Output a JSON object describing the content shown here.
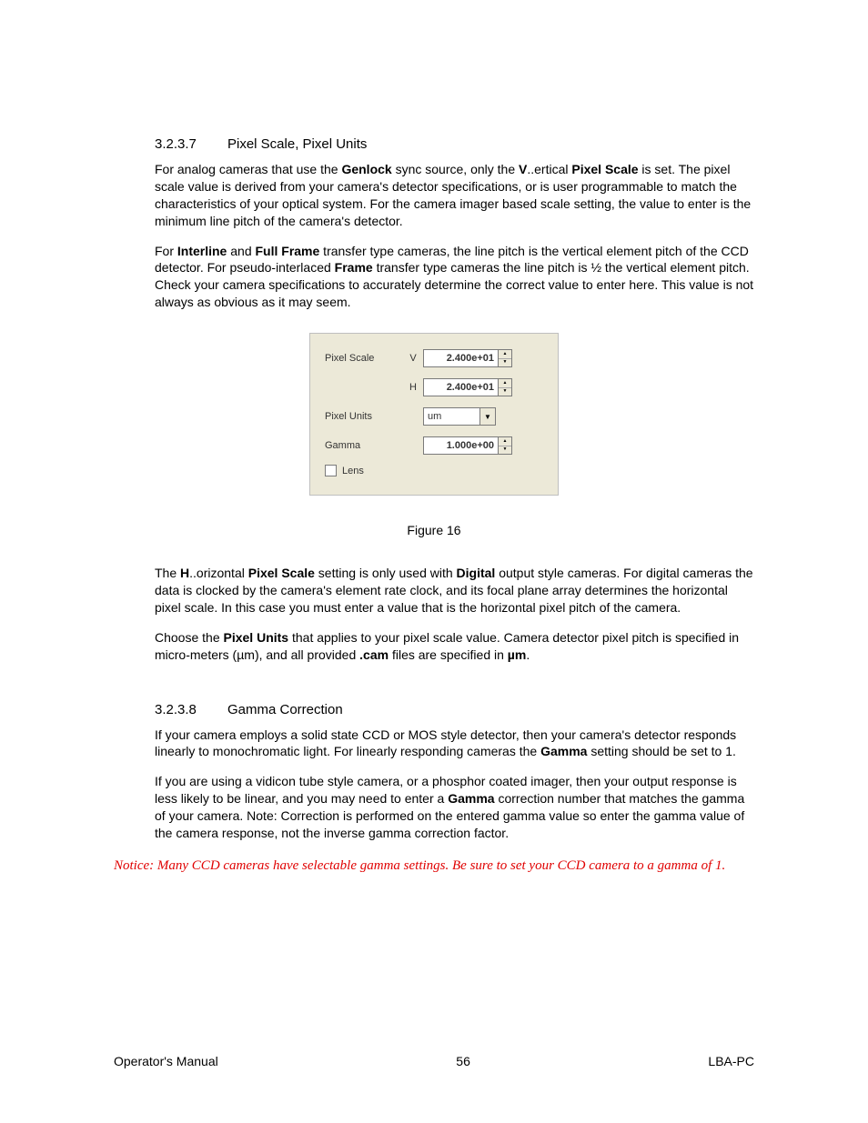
{
  "section1": {
    "number": "3.2.3.7",
    "title": "Pixel Scale, Pixel Units",
    "p1_a": "For analog cameras that use the ",
    "p1_b": "Genlock",
    "p1_c": " sync source, only the ",
    "p1_d": "V",
    "p1_e": "..ertical ",
    "p1_f": "Pixel Scale",
    "p1_g": " is set.  The pixel scale value is derived from your camera's detector specifications, or is user programmable to match the characteristics of your optical system.  For the camera imager based scale setting, the value to enter is the minimum line pitch of the camera's detector.",
    "p2_a": "For ",
    "p2_b": "Interline",
    "p2_c": " and ",
    "p2_d": "Full Frame",
    "p2_e": " transfer type cameras, the line pitch is the vertical element pitch of the CCD detector.  For pseudo-interlaced ",
    "p2_f": "Frame",
    "p2_g": " transfer type cameras the line pitch is ½ the vertical element pitch.  Check your camera specifications to accurately determine the correct value to enter here.  This value is not always as obvious as it may seem.",
    "p3_a": "The ",
    "p3_b": "H",
    "p3_c": "..orizontal ",
    "p3_d": "Pixel Scale",
    "p3_e": " setting is only used with ",
    "p3_f": "Digital",
    "p3_g": " output style cameras.  For digital cameras the data is clocked by the camera's element rate clock, and its focal plane array determines the horizontal pixel scale.  In this case you must enter a value that is the horizontal pixel pitch of the camera.",
    "p4_a": "Choose the ",
    "p4_b": "Pixel Units",
    "p4_c": " that applies to your pixel scale value.  Camera detector pixel pitch is specified in micro-meters (µm), and all provided ",
    "p4_d": ".cam",
    "p4_e": " files are specified in ",
    "p4_f": "µm",
    "p4_g": "."
  },
  "dialog": {
    "pixel_scale_label": "Pixel Scale",
    "v_letter": "V",
    "v_value": "2.400e+01",
    "h_letter": "H",
    "h_value": "2.400e+01",
    "pixel_units_label": "Pixel Units",
    "units_value": "um",
    "gamma_label": "Gamma",
    "gamma_value": "1.000e+00",
    "lens_label": "Lens"
  },
  "figure_caption": "Figure 16",
  "section2": {
    "number": "3.2.3.8",
    "title": "Gamma Correction",
    "p1_a": "If your camera employs a solid state CCD or MOS style detector, then your camera's detector responds linearly to monochromatic light.  For linearly responding cameras the ",
    "p1_b": "Gamma",
    "p1_c": " setting should be set to 1.",
    "p2_a": "If you are using a vidicon tube style camera, or a phosphor coated imager, then your output response is less likely to be linear, and you may need to enter a ",
    "p2_b": "Gamma",
    "p2_c": " correction number that matches the gamma of your camera.  Note: Correction is performed on the entered gamma value so enter the gamma value of the camera response, not the inverse gamma correction factor."
  },
  "notice": "Notice:  Many CCD cameras have selectable gamma settings.  Be sure to set your CCD camera to a gamma of 1.",
  "footer": {
    "left": "Operator's Manual",
    "center": "56",
    "right": "LBA-PC"
  }
}
